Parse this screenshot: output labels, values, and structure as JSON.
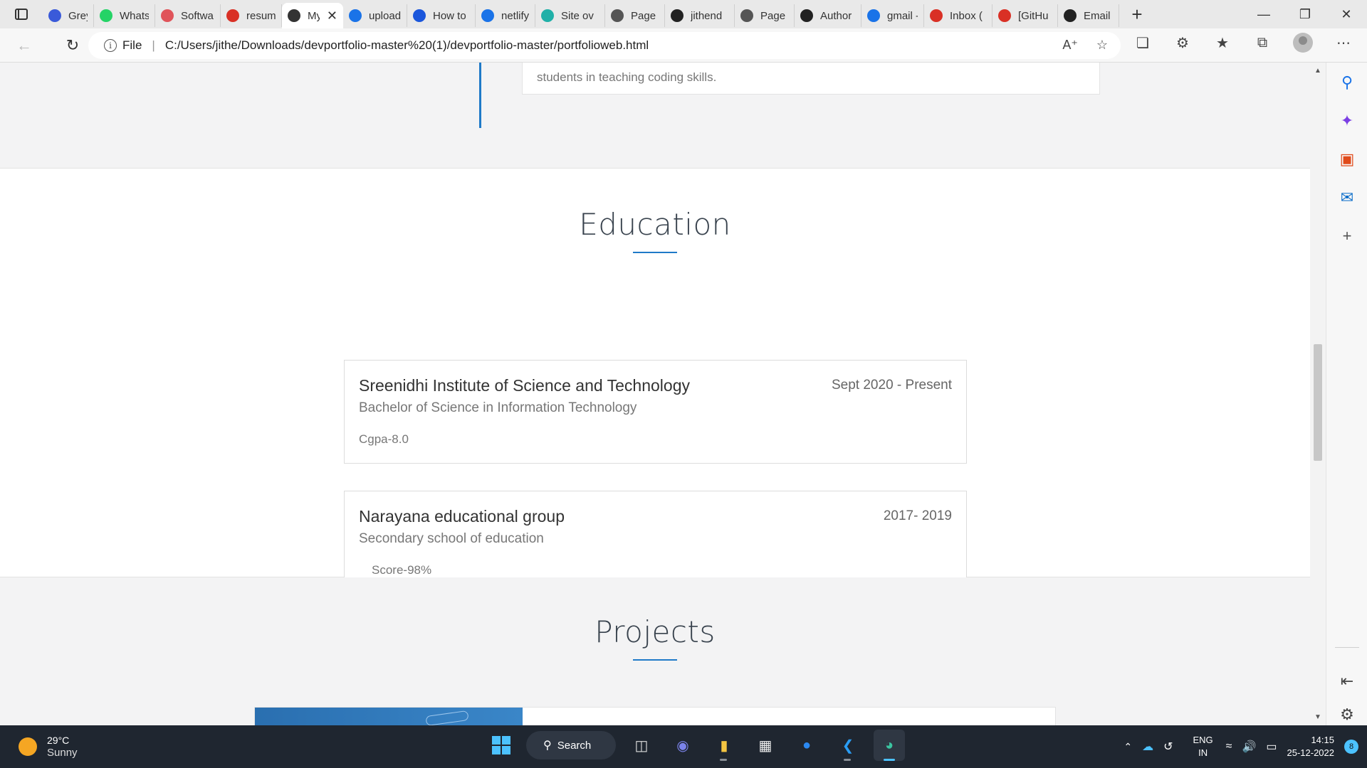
{
  "tabs": [
    {
      "label": "Grey Cl",
      "icon": "grey-icon",
      "color": "#3a5ad9",
      "active": false
    },
    {
      "label": "Whats",
      "icon": "whatsapp-icon",
      "color": "#25d366",
      "active": false
    },
    {
      "label": "Softwa",
      "icon": "software-icon",
      "color": "#e0545a",
      "active": false
    },
    {
      "label": "resume",
      "icon": "pdf-icon",
      "color": "#d93025",
      "active": false
    },
    {
      "label": "My",
      "icon": "code-icon",
      "color": "#333333",
      "active": true
    },
    {
      "label": "upload",
      "icon": "search-icon",
      "color": "#1a73e8",
      "active": false
    },
    {
      "label": "How to",
      "icon": "bing-chat-icon",
      "color": "#1a56db",
      "active": false
    },
    {
      "label": "netlify",
      "icon": "search-icon",
      "color": "#1a73e8",
      "active": false
    },
    {
      "label": "Site ov",
      "icon": "netlify-icon",
      "color": "#20b0a8",
      "active": false
    },
    {
      "label": "Page N",
      "icon": "page-icon",
      "color": "#555555",
      "active": false
    },
    {
      "label": "jithend",
      "icon": "github-icon",
      "color": "#222222",
      "active": false
    },
    {
      "label": "Page N",
      "icon": "page-icon",
      "color": "#555555",
      "active": false
    },
    {
      "label": "Author",
      "icon": "github-icon",
      "color": "#222222",
      "active": false
    },
    {
      "label": "gmail -",
      "icon": "search-icon",
      "color": "#1a73e8",
      "active": false
    },
    {
      "label": "Inbox (",
      "icon": "gmail-icon",
      "color": "#d93025",
      "active": false
    },
    {
      "label": "[GitHu",
      "icon": "gmail-icon",
      "color": "#d93025",
      "active": false
    },
    {
      "label": "Email s",
      "icon": "github-icon",
      "color": "#222222",
      "active": false
    }
  ],
  "address": {
    "scheme_label": "File",
    "url": "C:/Users/jithe/Downloads/devportfolio-master%20(1)/devportfolio-master/portfolioweb.html"
  },
  "experience": {
    "tail_text": "students in teaching coding skills."
  },
  "education": {
    "title": "Education",
    "items": [
      {
        "school": "Sreenidhi Institute of Science and Technology",
        "degree": "Bachelor of Science in Information Technology",
        "score": "Cgpa-8.0",
        "dates": "Sept 2020 - Present"
      },
      {
        "school": "Narayana educational group",
        "degree": "Secondary school of education",
        "score": "Score-98%",
        "dates": "2017- 2019"
      }
    ]
  },
  "projects": {
    "title": "Projects"
  },
  "taskbar": {
    "temperature": "29°C",
    "condition": "Sunny",
    "search_label": "Search",
    "language": "ENG",
    "region": "IN",
    "time": "14:15",
    "date": "25-12-2022",
    "notifications": "8"
  },
  "colors": {
    "accent": "#1f7ac8",
    "taskbar": "#1f2630",
    "windows_blue": "#4cc2ff"
  }
}
